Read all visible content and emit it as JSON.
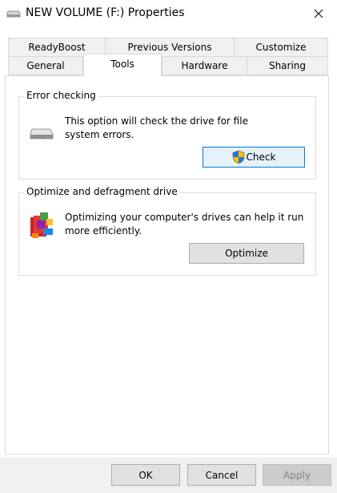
{
  "window": {
    "title": "NEW VOLUME (F:) Properties"
  },
  "tabs": {
    "row1": [
      {
        "label": "ReadyBoost"
      },
      {
        "label": "Previous Versions"
      },
      {
        "label": "Customize"
      }
    ],
    "row2": [
      {
        "label": "General"
      },
      {
        "label": "Tools",
        "active": true
      },
      {
        "label": "Hardware"
      },
      {
        "label": "Sharing"
      }
    ]
  },
  "error_checking": {
    "title": "Error checking",
    "description_line1": "This option will check the drive for file",
    "description_line2": "system errors.",
    "check_label": "Check",
    "icon": "drive-icon"
  },
  "optimize": {
    "title": "Optimize and defragment drive",
    "description_line1": "Optimizing your computer's drives can help it run",
    "description_line2": "more efficiently.",
    "optimize_label": "Optimize",
    "icon": "defrag-icon"
  },
  "footer": {
    "ok_label": "OK",
    "cancel_label": "Cancel",
    "apply_label": "Apply"
  },
  "colors": {
    "focus_border": "#0078d7",
    "button_face": "#e1e1e1",
    "dialog_bg": "#f0f0f0"
  }
}
